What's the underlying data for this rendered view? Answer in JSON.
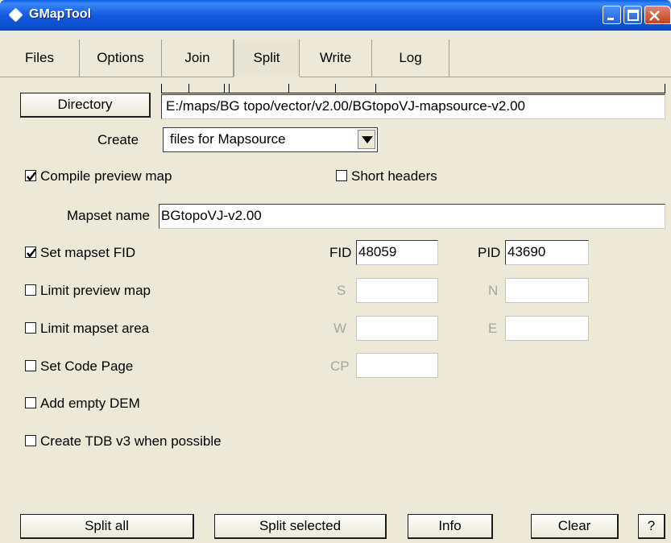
{
  "window": {
    "title": "GMapTool",
    "controls": [
      "minimize-icon",
      "maximize-icon",
      "close-icon"
    ]
  },
  "tabs": [
    {
      "label": "Files"
    },
    {
      "label": "Options"
    },
    {
      "label": "Join"
    },
    {
      "label": "Split",
      "active": true
    },
    {
      "label": "Write"
    },
    {
      "label": "Log"
    }
  ],
  "directory": {
    "button_label": "Directory",
    "value": "E:/maps/BG topo/vector/v2.00/BGtopoVJ-mapsource-v2.00"
  },
  "create": {
    "label": "Create",
    "selected": "files for Mapsource"
  },
  "options": {
    "compile_preview": {
      "label": "Compile preview map",
      "checked": true
    },
    "short_headers": {
      "label": "Short headers",
      "checked": false
    },
    "mapset_name": {
      "label": "Mapset name",
      "value": "BGtopoVJ-v2.00"
    },
    "set_mapset_fid": {
      "label": "Set mapset FID",
      "checked": true
    },
    "fid": {
      "label": "FID",
      "value": "48059"
    },
    "pid": {
      "label": "PID",
      "value": "43690"
    },
    "limit_preview": {
      "label": "Limit preview map",
      "checked": false
    },
    "s": {
      "label": "S",
      "value": ""
    },
    "n": {
      "label": "N",
      "value": ""
    },
    "limit_area": {
      "label": "Limit mapset area",
      "checked": false
    },
    "w": {
      "label": "W",
      "value": ""
    },
    "e": {
      "label": "E",
      "value": ""
    },
    "code_page": {
      "label": "Set Code Page",
      "checked": false
    },
    "cp": {
      "label": "CP",
      "value": ""
    },
    "empty_dem": {
      "label": "Add empty DEM",
      "checked": false
    },
    "tdb_v3": {
      "label": "Create TDB v3 when possible",
      "checked": false
    }
  },
  "actions": {
    "split_all": "Split all",
    "split_selected": "Split selected",
    "info": "Info",
    "clear": "Clear",
    "help": "?"
  },
  "colors": {
    "titlebar": "#0b4fd0",
    "window_bg": "#ece9d8"
  }
}
